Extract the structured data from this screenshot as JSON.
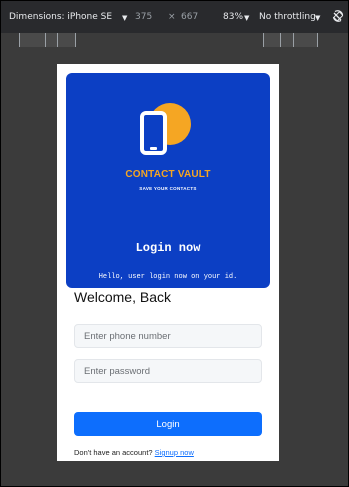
{
  "devtools": {
    "dimensions_label": "Dimensions: iPhone SE",
    "width": "375",
    "times": "×",
    "height": "667",
    "zoom": "83%",
    "throttling": "No throttling",
    "arrow": "▼"
  },
  "app": {
    "brand": "CONTACT VAULT",
    "tagline": "SAVE YOUR CONTACTS",
    "hero_title": "Login now",
    "hero_subtitle": "Hello, user login now on your id.",
    "welcome": "Welcome, Back",
    "phone_placeholder": "Enter phone number",
    "password_placeholder": "Enter password",
    "login_button": "Login",
    "signup_prompt": "Don't have an account?",
    "signup_link": "Signup now"
  },
  "colors": {
    "hero_bg": "#0c3fc4",
    "brand": "#f5a623",
    "button": "#0d6efd"
  }
}
